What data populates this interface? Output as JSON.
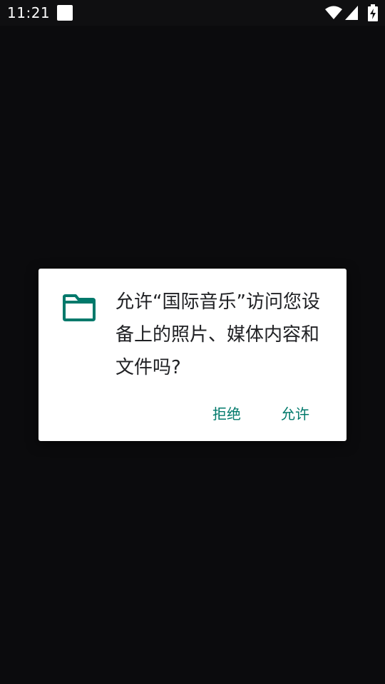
{
  "status_bar": {
    "time": "11:21",
    "icons": [
      "notification-square-icon",
      "wifi-icon",
      "cell-signal-icon",
      "battery-charging-icon"
    ]
  },
  "dialog": {
    "icon": "folder-icon",
    "message": "允许“国际音乐”访问您设备上的照片、媒体内容和文件吗?",
    "deny_label": "拒绝",
    "allow_label": "允许"
  },
  "colors": {
    "background": "#0b0b0d",
    "dialog_bg": "#ffffff",
    "accent": "#00796b",
    "text": "#202124"
  }
}
